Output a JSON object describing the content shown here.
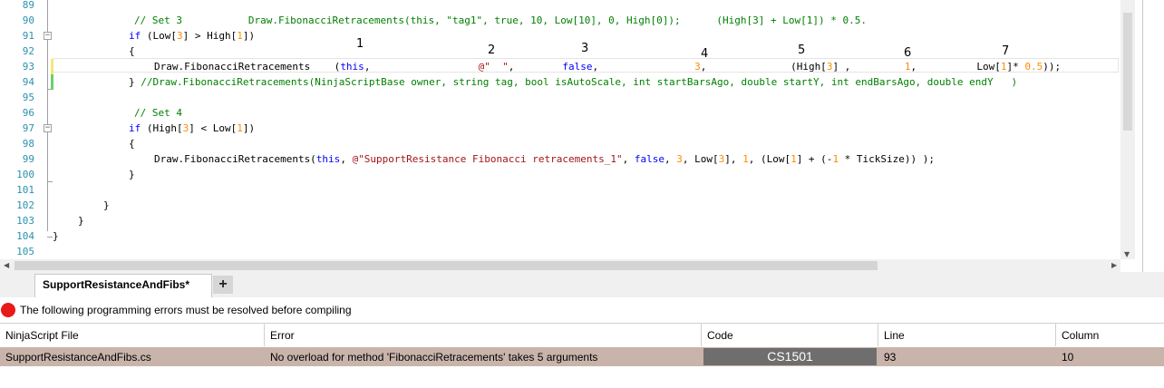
{
  "editor": {
    "lines": [
      {
        "num": "89"
      },
      {
        "num": "90"
      },
      {
        "num": "91"
      },
      {
        "num": "92"
      },
      {
        "num": "93"
      },
      {
        "num": "94"
      },
      {
        "num": "95"
      },
      {
        "num": "96"
      },
      {
        "num": "97"
      },
      {
        "num": "98"
      },
      {
        "num": "99"
      },
      {
        "num": "100"
      },
      {
        "num": "101"
      },
      {
        "num": "102"
      },
      {
        "num": "103"
      },
      {
        "num": "104"
      },
      {
        "num": "105"
      }
    ],
    "annotations": [
      "1",
      "2",
      "3",
      "4",
      "5",
      "6",
      "7"
    ]
  },
  "tabs": {
    "active_label": "SupportResistanceAndFibs*",
    "add_label": "+"
  },
  "errors": {
    "message": "The following programming errors must be resolved before compiling",
    "columns": [
      "NinjaScript File",
      "Error",
      "Code",
      "Line",
      "Column"
    ],
    "rows": [
      {
        "file": "SupportResistanceAndFibs.cs",
        "error": "No overload for method 'FibonacciRetracements' takes 5 arguments",
        "code": "CS1501",
        "line": "93",
        "column": "10"
      }
    ]
  }
}
